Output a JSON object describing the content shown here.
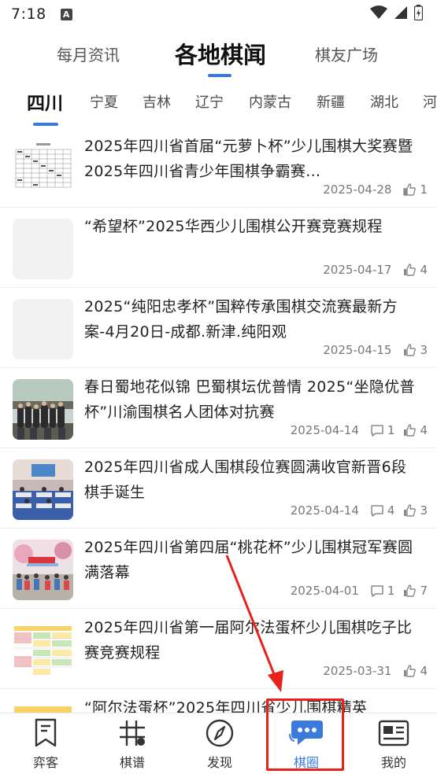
{
  "status_bar": {
    "time": "7:18",
    "notif_icon": "A"
  },
  "top_tabs": [
    {
      "label": "每月资讯",
      "active": false
    },
    {
      "label": "各地棋闻",
      "active": true
    },
    {
      "label": "棋友广场",
      "active": false
    }
  ],
  "province_tabs": [
    {
      "label": "四川",
      "active": true
    },
    {
      "label": "宁夏"
    },
    {
      "label": "吉林"
    },
    {
      "label": "辽宁"
    },
    {
      "label": "内蒙古"
    },
    {
      "label": "新疆"
    },
    {
      "label": "湖北"
    },
    {
      "label": "河"
    }
  ],
  "news": [
    {
      "title": "2025年四川省首届“元萝卜杯”少儿围棋大奖赛暨2025年四川省青少年围棋争霸赛…",
      "date": "2025-04-28",
      "comments": null,
      "likes": "1",
      "thumb": "table-doc"
    },
    {
      "title": "“希望杯”2025华西少儿围棋公开赛竞赛规程",
      "date": "2025-04-17",
      "comments": null,
      "likes": "4",
      "thumb": "blank"
    },
    {
      "title": "2025“纯阳忠孝杯”国粹传承围棋交流赛最新方案-4月20日-成都.新津.纯阳观",
      "date": "2025-04-15",
      "comments": null,
      "likes": "3",
      "thumb": "blank"
    },
    {
      "title": "春日蜀地花似锦 巴蜀棋坛优普情 2025“坐隐优普杯”川渝围棋名人团体对抗赛",
      "date": "2025-04-14",
      "comments": "1",
      "likes": "4",
      "thumb": "group-photo"
    },
    {
      "title": "2025年四川省成人围棋段位赛圆满收官新晋6段棋手诞生",
      "date": "2025-04-14",
      "comments": "4",
      "likes": "3",
      "thumb": "hall-photo"
    },
    {
      "title": "2025年四川省第四届“桃花杯”少儿围棋冠军赛圆满落幕",
      "date": "2025-04-01",
      "comments": "1",
      "likes": "7",
      "thumb": "outdoor-photo"
    },
    {
      "title": "2025年四川省第一届阿尔法蛋杯少儿围棋吃子比赛竞赛规程",
      "date": "2025-03-31",
      "comments": null,
      "likes": "4",
      "thumb": "color-table"
    },
    {
      "title": "“阿尔法蛋杯”2025年四川省少儿围棋精英",
      "date": "",
      "comments": null,
      "likes": "",
      "thumb": "color-table-2"
    }
  ],
  "bottom_nav": [
    {
      "label": "弈客",
      "icon": "bookmark-icon",
      "active": false
    },
    {
      "label": "棋谱",
      "icon": "grid-board-icon",
      "active": false
    },
    {
      "label": "发现",
      "icon": "compass-icon",
      "active": false
    },
    {
      "label": "棋圈",
      "icon": "chat-bubble-icon",
      "active": true
    },
    {
      "label": "我的",
      "icon": "profile-card-icon",
      "active": false
    }
  ],
  "colors": {
    "accent": "#3b7ad9",
    "annotation": "#e8211a"
  }
}
